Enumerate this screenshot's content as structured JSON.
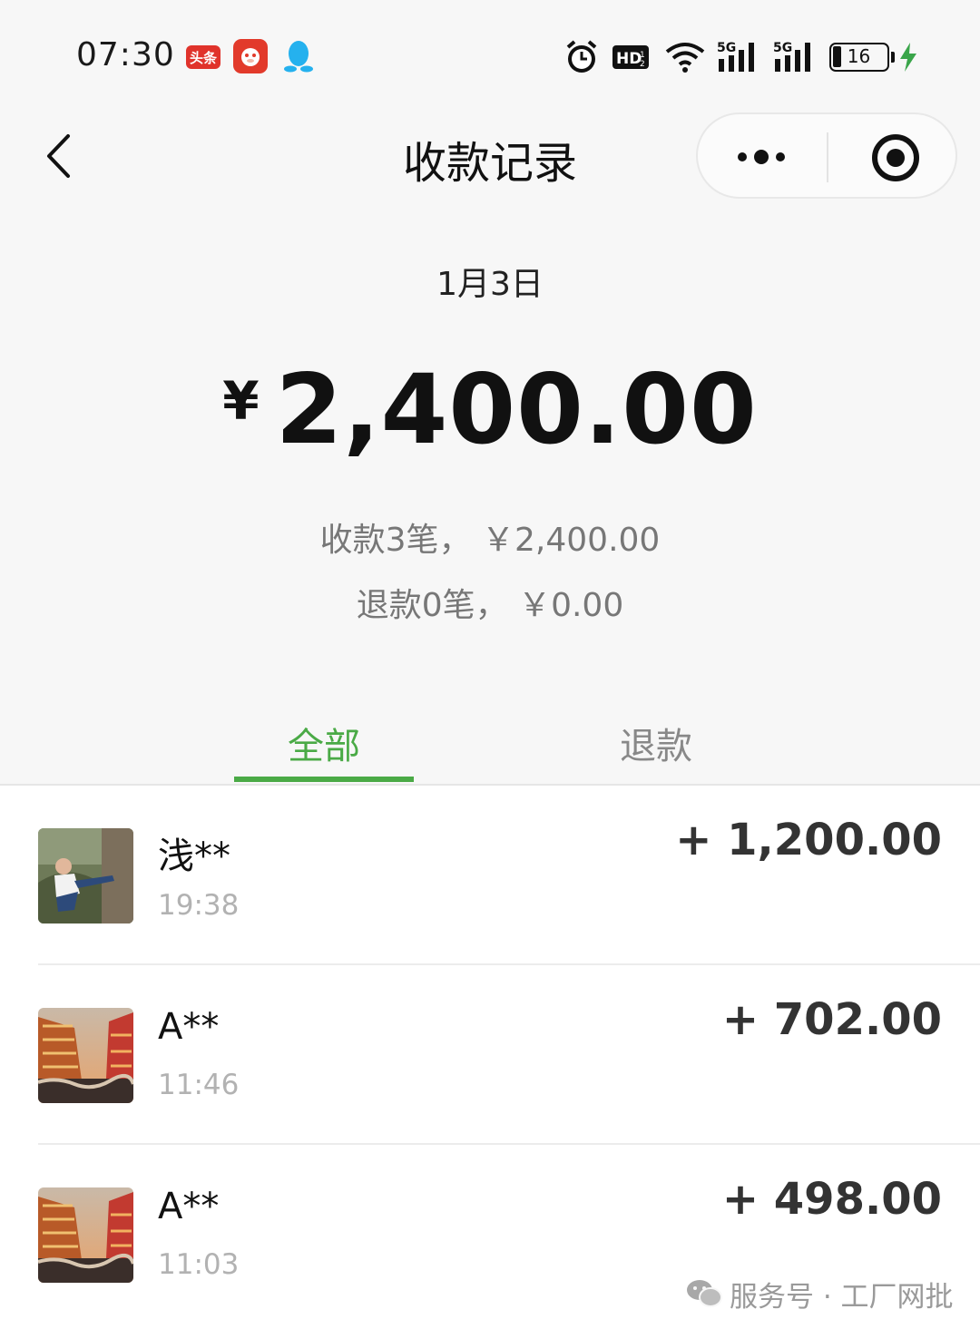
{
  "status_bar": {
    "time": "07:30",
    "toutiao_label": "头条",
    "battery_level": "16",
    "icons": [
      "toutiao-icon",
      "red-app-icon",
      "qq-icon",
      "alarm-icon",
      "hd-icon",
      "wifi-icon",
      "signal-5g-icon",
      "signal-5g-icon",
      "battery-icon",
      "charging-icon"
    ]
  },
  "header": {
    "title": "收款记录"
  },
  "summary": {
    "date": "1月3日",
    "currency": "¥",
    "total": "2,400.00",
    "received_line": "收款3笔， ￥2,400.00",
    "refund_line": "退款0笔， ￥0.00"
  },
  "tabs": [
    {
      "label": "全部",
      "active": true
    },
    {
      "label": "退款",
      "active": false
    }
  ],
  "records": [
    {
      "name": "浅**",
      "time": "19:38",
      "amount": "+ 1,200.00"
    },
    {
      "name": "A**",
      "time": "11:46",
      "amount": "+ 702.00"
    },
    {
      "name": "A**",
      "time": "11:03",
      "amount": "+ 498.00"
    }
  ],
  "watermark": {
    "text": "服务号 · 工厂网批"
  },
  "colors": {
    "accent": "#4aaa46",
    "background": "#f7f7f7"
  }
}
